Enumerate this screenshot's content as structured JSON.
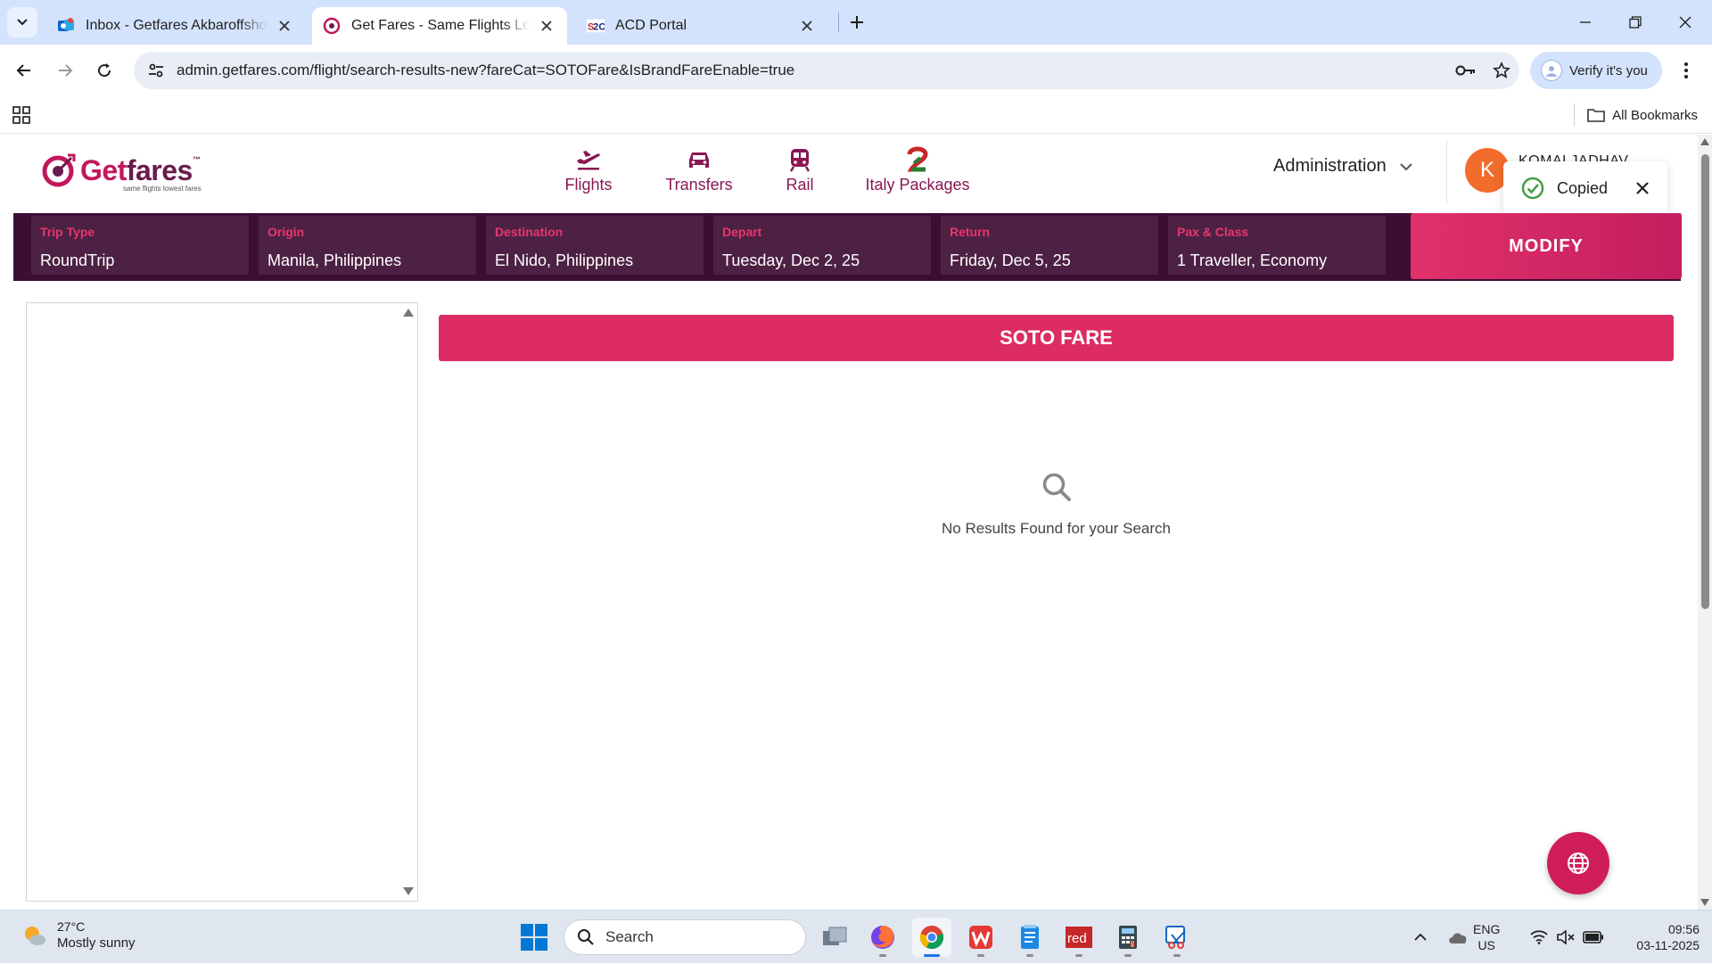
{
  "browser": {
    "tabs": [
      {
        "title": "Inbox - Getfares Akbaroffshore",
        "active": false
      },
      {
        "title": "Get Fares - Same Flights Lowest Fares",
        "active": true
      },
      {
        "title": "ACD Portal",
        "active": false
      }
    ],
    "url": "admin.getfares.com/flight/search-results-new?fareCat=SOTOFare&IsBrandFareEnable=true",
    "verify_label": "Verify it's you",
    "all_bookmarks": "All Bookmarks"
  },
  "site": {
    "logo": {
      "brand_a": "Get",
      "brand_b": "fares",
      "tm": "™",
      "tagline": "same flights lowest fares"
    },
    "nav": [
      {
        "label": "Flights",
        "icon": "plane-icon"
      },
      {
        "label": "Transfers",
        "icon": "car-icon"
      },
      {
        "label": "Rail",
        "icon": "train-icon"
      },
      {
        "label": "Italy Packages",
        "icon": "italy-packages-icon"
      }
    ],
    "admin_label": "Administration",
    "user": {
      "initial": "K",
      "name": "KOMALJADHAV"
    },
    "toast": {
      "text": "Copied"
    }
  },
  "search": {
    "fields": [
      {
        "label": "Trip Type",
        "value": "RoundTrip"
      },
      {
        "label": "Origin",
        "value": "Manila, Philippines"
      },
      {
        "label": "Destination",
        "value": "El Nido, Philippines"
      },
      {
        "label": "Depart",
        "value": "Tuesday, Dec 2, 25"
      },
      {
        "label": "Return",
        "value": "Friday, Dec 5, 25"
      },
      {
        "label": "Pax & Class",
        "value": "1 Traveller, Economy"
      }
    ],
    "modify_label": "MODIFY"
  },
  "results": {
    "banner": "SOTO FARE",
    "empty_message": "No Results Found for your Search"
  },
  "taskbar": {
    "weather": {
      "temp": "27°C",
      "desc": "Mostly sunny"
    },
    "search_placeholder": "Search",
    "lang": {
      "line1": "ENG",
      "line2": "US"
    },
    "clock": {
      "time": "09:56",
      "date": "03-11-2025"
    }
  },
  "colors": {
    "accent": "#dd2c63",
    "searchbar_bg": "#3d0e33",
    "field_bg": "#4d2143",
    "nav_text": "#8a1752",
    "avatar": "#f26c2b"
  }
}
